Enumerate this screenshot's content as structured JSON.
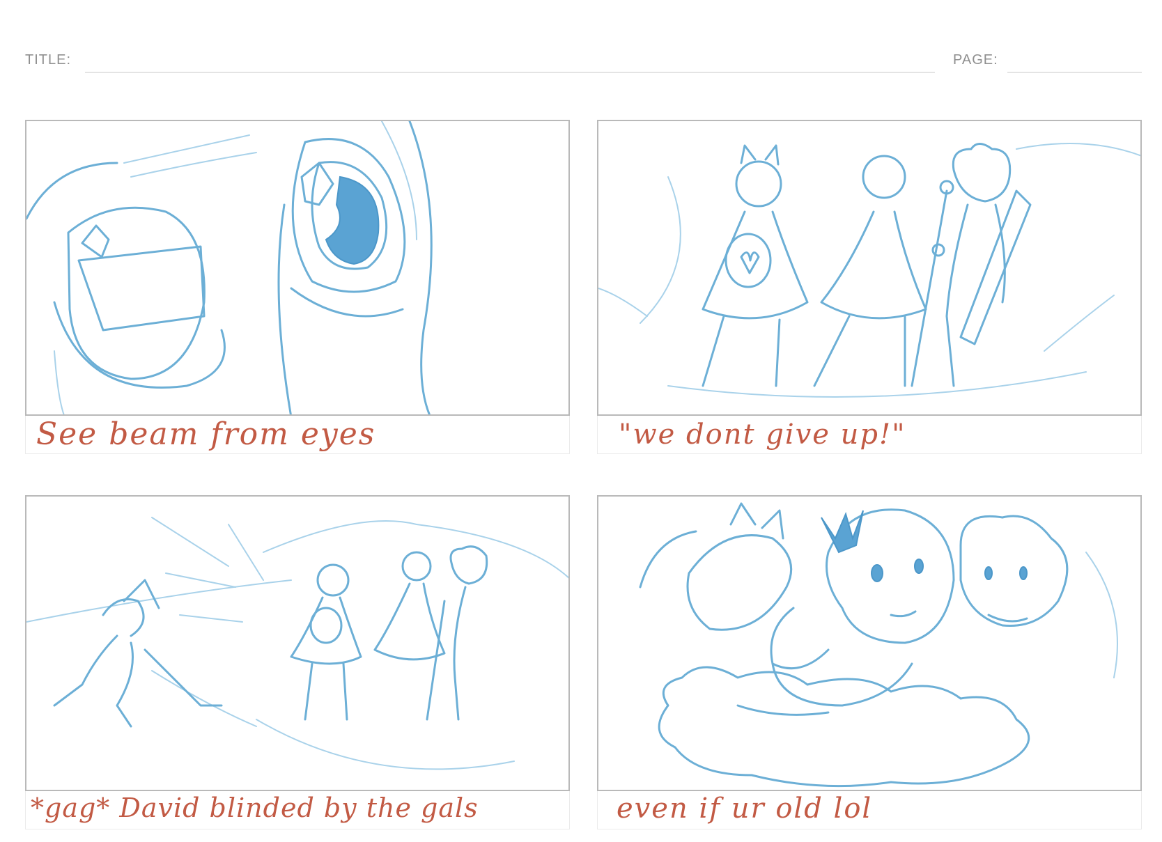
{
  "header": {
    "title_label": "TITLE:",
    "page_label": "PAGE:"
  },
  "panels": [
    {
      "caption": "See beam from eyes"
    },
    {
      "caption": "\"we dont give up!\""
    },
    {
      "caption": "*gag* David blinded by the gals"
    },
    {
      "caption": "even if ur old lol"
    }
  ],
  "colors": {
    "sketch_line": "#6cafd6",
    "caption_text": "#c25a44",
    "panel_border": "#b9b9b9"
  }
}
